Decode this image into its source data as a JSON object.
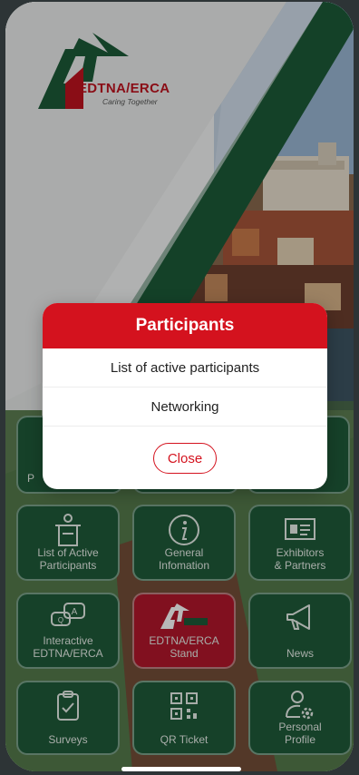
{
  "brand": {
    "name": "EDTNA/ERCA",
    "tagline": "Caring Together",
    "green": "#1f5b3a",
    "red": "#d4121e"
  },
  "modal": {
    "title": "Participants",
    "items": [
      "List of active participants",
      "Networking"
    ],
    "close_label": "Close"
  },
  "tiles_partial": [
    {
      "label": "P",
      "icon": "partial-tile"
    }
  ],
  "tiles": [
    {
      "label": "List of Active\nParticipants",
      "icon": "podium-icon",
      "color": "green"
    },
    {
      "label": "General\nInfomation",
      "icon": "info-icon",
      "color": "green"
    },
    {
      "label": "Exhibitors\n& Partners",
      "icon": "exhibitor-board-icon",
      "color": "green"
    },
    {
      "label": "Interactive\nEDTNA/ERCA",
      "icon": "chat-bubbles-icon",
      "color": "green"
    },
    {
      "label": "EDTNA/ERCA\nStand",
      "icon": "edtna-logo-icon",
      "color": "red"
    },
    {
      "label": "News",
      "icon": "megaphone-icon",
      "color": "green"
    },
    {
      "label": "Surveys",
      "icon": "clipboard-check-icon",
      "color": "green"
    },
    {
      "label": "QR Ticket",
      "icon": "qr-code-icon",
      "color": "green"
    },
    {
      "label": "Personal\nProfile",
      "icon": "user-settings-icon",
      "color": "green"
    }
  ]
}
